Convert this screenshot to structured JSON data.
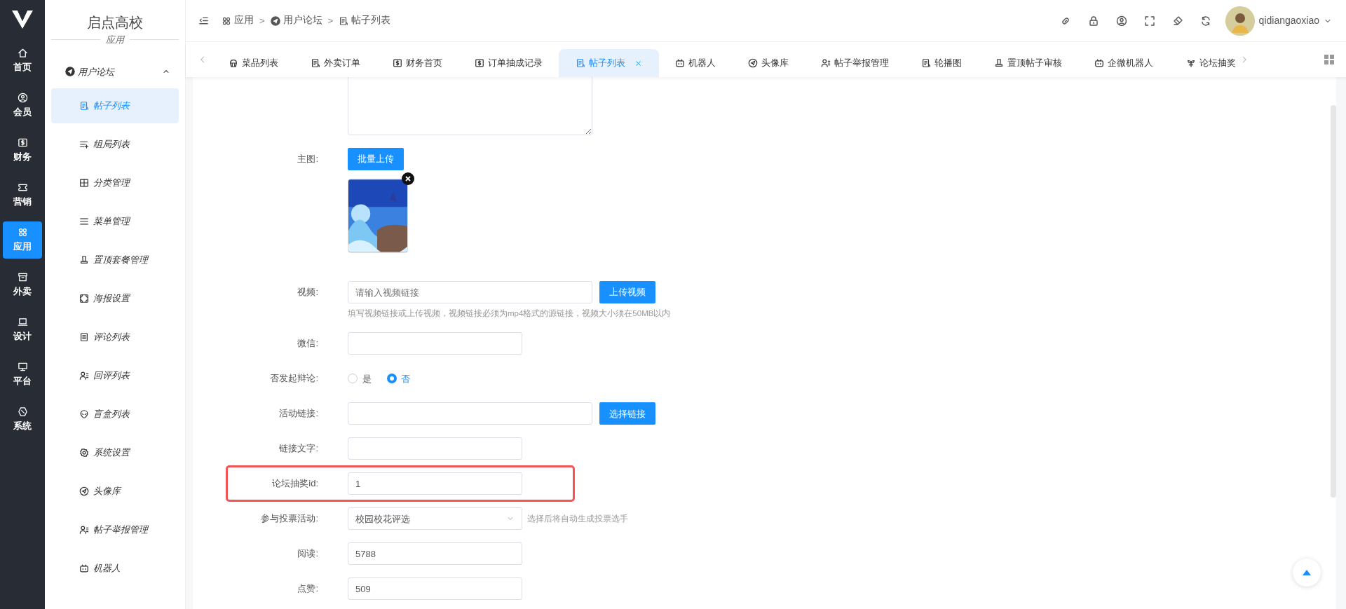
{
  "rail": {
    "items": [
      {
        "label": "首页",
        "selected": false
      },
      {
        "label": "会员",
        "selected": false
      },
      {
        "label": "财务",
        "selected": false
      },
      {
        "label": "营销",
        "selected": false
      },
      {
        "label": "应用",
        "selected": true
      },
      {
        "label": "外卖",
        "selected": false
      },
      {
        "label": "设计",
        "selected": false
      },
      {
        "label": "平台",
        "selected": false
      },
      {
        "label": "系统",
        "selected": false
      }
    ]
  },
  "sidebar": {
    "title": "启点高校",
    "section": "应用",
    "group": {
      "label": "用户论坛",
      "expanded": true
    },
    "items": [
      {
        "label": "帖子列表",
        "selected": true
      },
      {
        "label": "组局列表",
        "selected": false
      },
      {
        "label": "分类管理",
        "selected": false
      },
      {
        "label": "菜单管理",
        "selected": false
      },
      {
        "label": "置顶套餐管理",
        "selected": false
      },
      {
        "label": "海报设置",
        "selected": false
      },
      {
        "label": "评论列表",
        "selected": false
      },
      {
        "label": "回评列表",
        "selected": false
      },
      {
        "label": "盲盒列表",
        "selected": false
      },
      {
        "label": "系统设置",
        "selected": false
      },
      {
        "label": "头像库",
        "selected": false
      },
      {
        "label": "帖子举报管理",
        "selected": false
      },
      {
        "label": "机器人",
        "selected": false
      }
    ]
  },
  "header": {
    "breadcrumbs": [
      "应用",
      "用户论坛",
      "帖子列表"
    ],
    "separator": ">",
    "username": "qidiangaoxiao"
  },
  "tabs": [
    {
      "label": "菜品列表",
      "selected": false
    },
    {
      "label": "外卖订单",
      "selected": false
    },
    {
      "label": "财务首页",
      "selected": false
    },
    {
      "label": "订单抽成记录",
      "selected": false
    },
    {
      "label": "帖子列表",
      "selected": true
    },
    {
      "label": "机器人",
      "selected": false
    },
    {
      "label": "头像库",
      "selected": false
    },
    {
      "label": "帖子举报管理",
      "selected": false
    },
    {
      "label": "轮播图",
      "selected": false
    },
    {
      "label": "置顶帖子审核",
      "selected": false
    },
    {
      "label": "企微机器人",
      "selected": false
    },
    {
      "label": "论坛抽奖",
      "selected": false
    }
  ],
  "form": {
    "fields": [
      {
        "kind": "textarea"
      },
      {
        "kind": "upload",
        "label": "主图:",
        "button": "批量上传"
      },
      {
        "kind": "input_button",
        "label": "视频:",
        "placeholder": "请输入视频链接",
        "button": "上传视频",
        "hint": "填写视频链接或上传视频，视频链接必须为mp4格式的源链接，视频大小须在50MB以内"
      },
      {
        "kind": "input",
        "label": "微信:"
      },
      {
        "kind": "radio",
        "label": "否发起辩论:",
        "options": [
          {
            "label": "是",
            "selected": false
          },
          {
            "label": "否",
            "selected": true
          }
        ]
      },
      {
        "kind": "input_button",
        "label": "活动链接:",
        "button": "选择链接"
      },
      {
        "kind": "input",
        "label": "链接文字:"
      },
      {
        "kind": "input",
        "label": "论坛抽奖id:",
        "value": "1",
        "highlighted": true
      },
      {
        "kind": "select",
        "label": "参与投票活动:",
        "value": "校园校花评选",
        "hint": "选择后将自动生成投票选手"
      },
      {
        "kind": "input",
        "label": "阅读:",
        "value": "5788"
      },
      {
        "kind": "input",
        "label": "点赞:",
        "value": "509"
      }
    ]
  }
}
